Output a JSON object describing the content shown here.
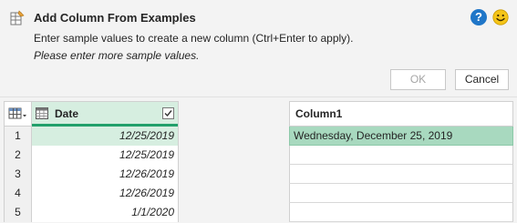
{
  "header": {
    "title": "Add Column From Examples",
    "subtitle": "Enter sample values to create a new column (Ctrl+Enter to apply).",
    "hint": "Please enter more sample values.",
    "help_icon": "?",
    "ok_label": "OK",
    "cancel_label": "Cancel"
  },
  "source_grid": {
    "column_header": "Date",
    "rows": [
      {
        "num": "1",
        "value": "12/25/2019"
      },
      {
        "num": "2",
        "value": "12/25/2019"
      },
      {
        "num": "3",
        "value": "12/26/2019"
      },
      {
        "num": "4",
        "value": "12/26/2019"
      },
      {
        "num": "5",
        "value": "1/1/2020"
      }
    ]
  },
  "example_grid": {
    "column_header": "Column1",
    "rows": [
      {
        "value": "Wednesday, December 25, 2019"
      },
      {
        "value": ""
      },
      {
        "value": ""
      },
      {
        "value": ""
      },
      {
        "value": ""
      }
    ]
  },
  "colors": {
    "accent": "#22a06b",
    "selected_bg": "#d6eee0",
    "example_bg": "#a8d9bf",
    "help_blue": "#1f76c8"
  }
}
